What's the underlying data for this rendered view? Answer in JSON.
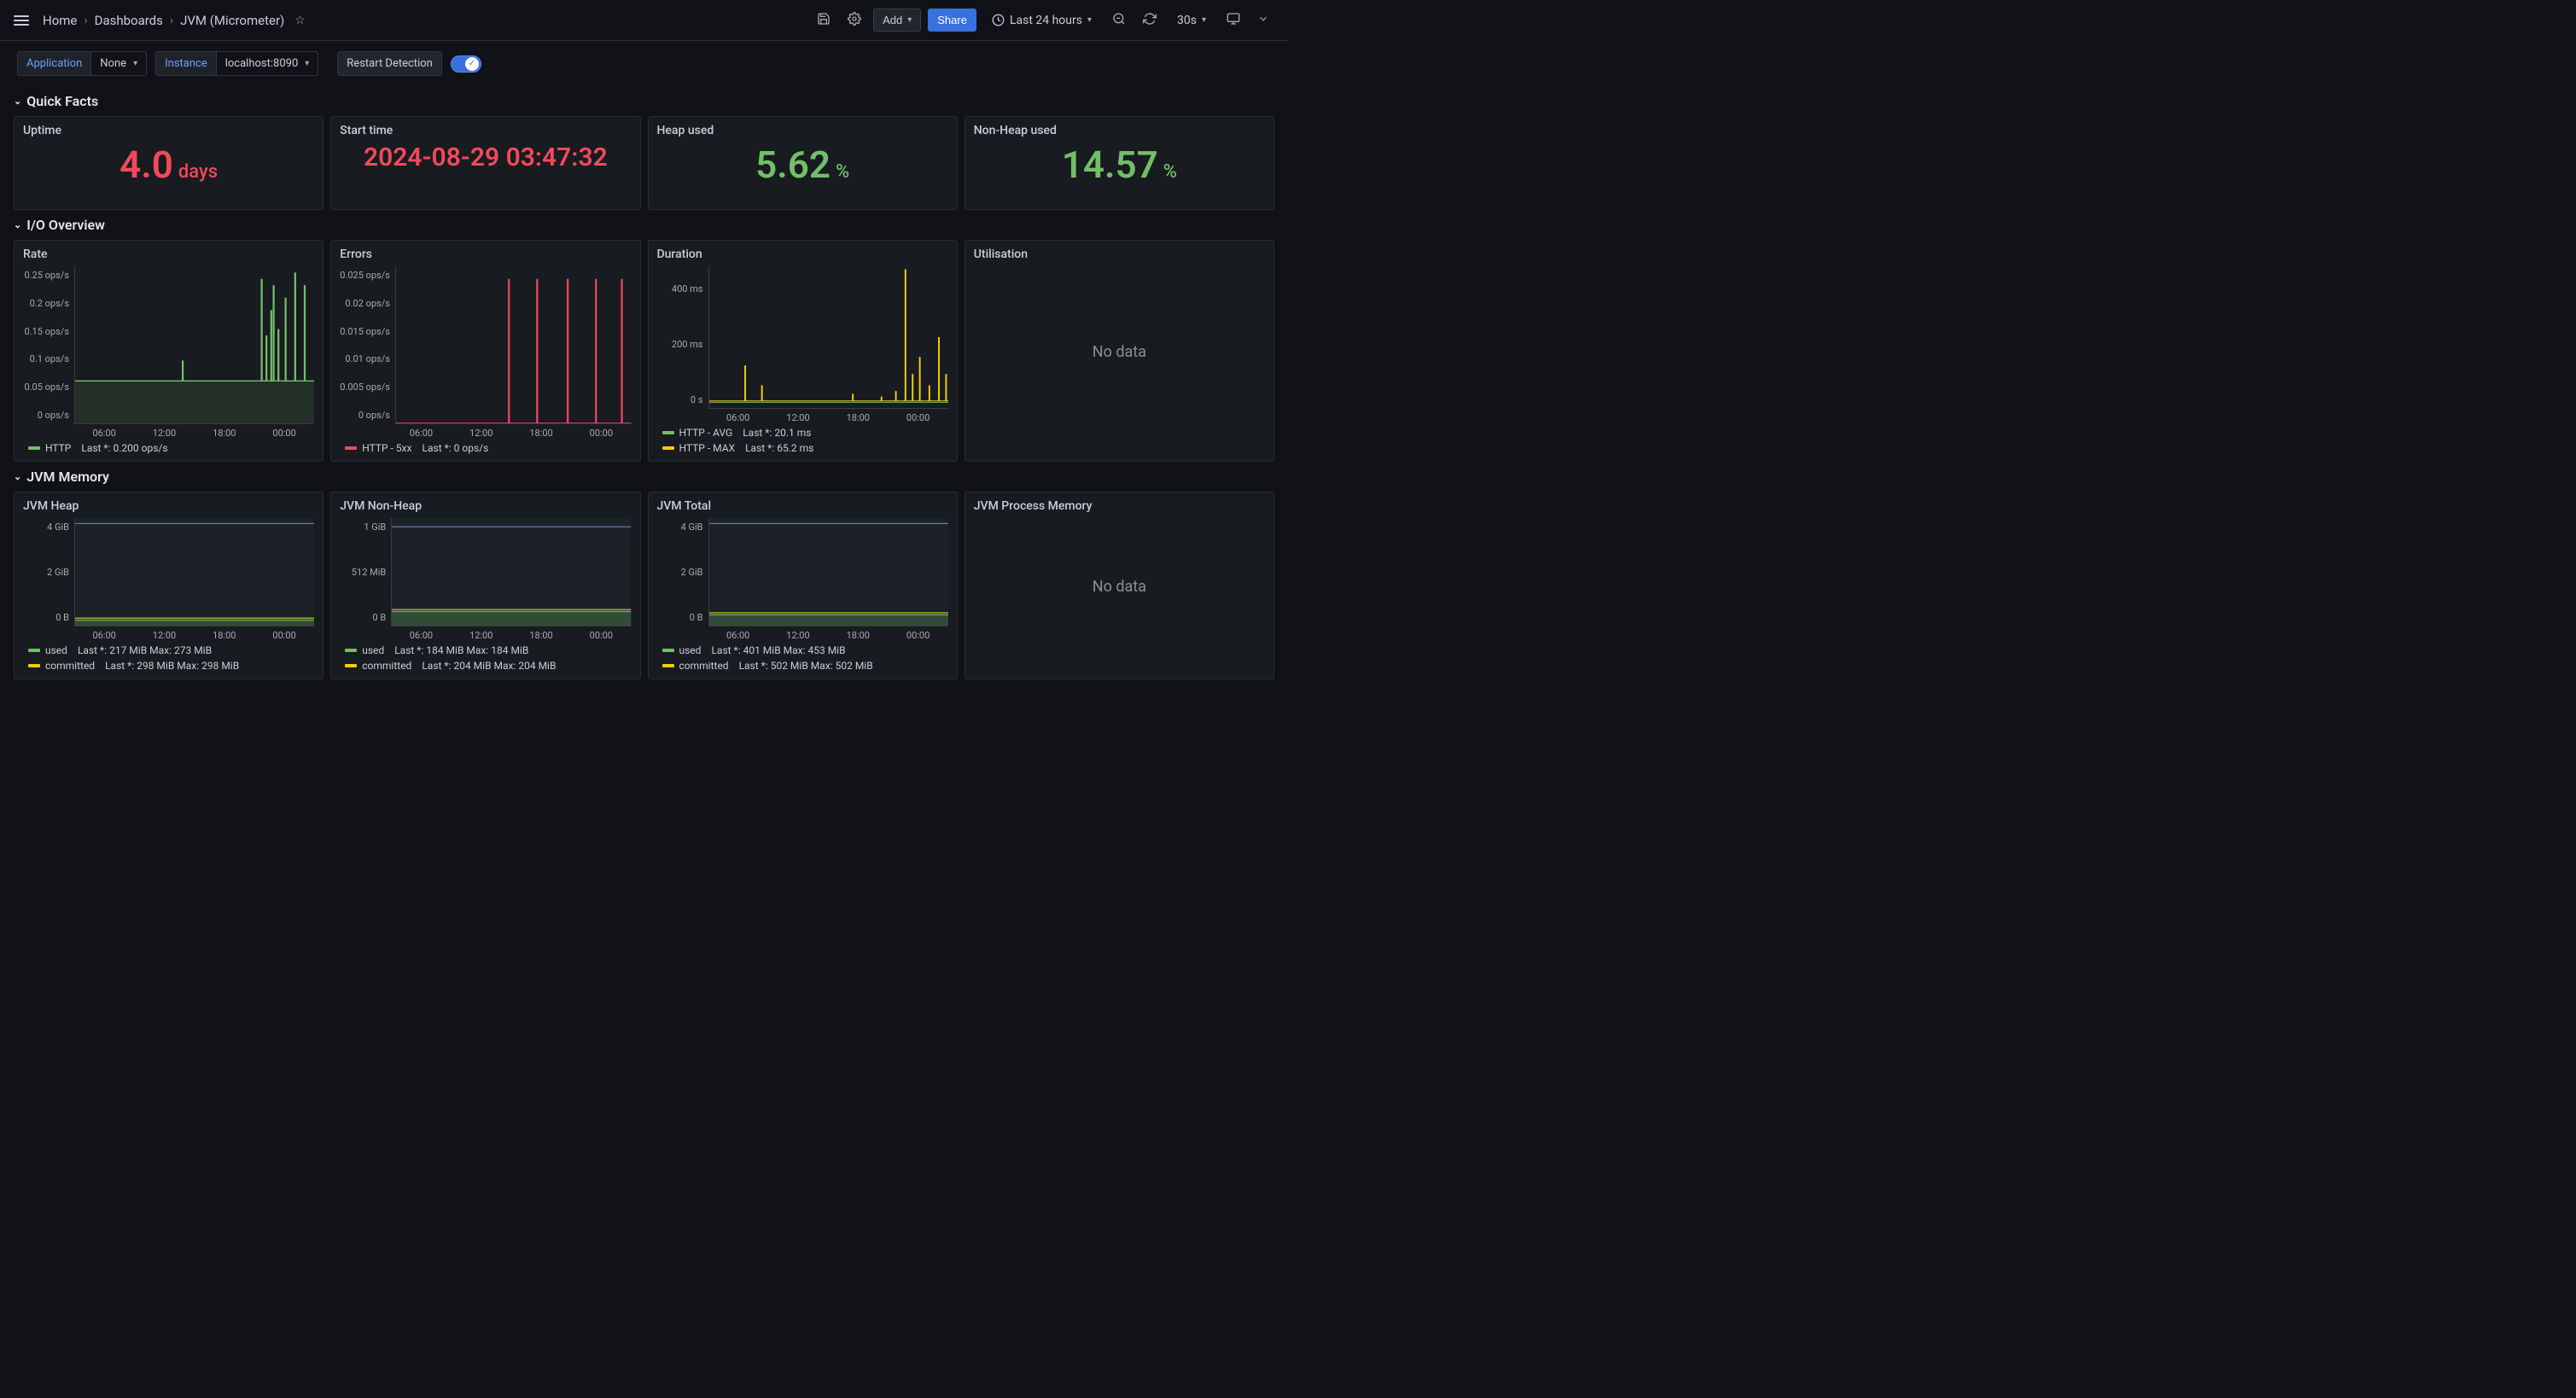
{
  "breadcrumbs": {
    "home": "Home",
    "dashboards": "Dashboards",
    "current": "JVM (Micrometer)"
  },
  "toolbar": {
    "add": "Add",
    "share": "Share",
    "timerange": "Last 24 hours",
    "refresh_interval": "30s"
  },
  "variables": {
    "application_label": "Application",
    "application_value": "None",
    "instance_label": "Instance",
    "instance_value": "localhost:8090",
    "restart_label": "Restart Detection"
  },
  "sections": {
    "quick_facts": "Quick Facts",
    "io_overview": "I/O Overview",
    "jvm_memory": "JVM Memory"
  },
  "quick_facts": {
    "uptime": {
      "title": "Uptime",
      "value": "4.0",
      "unit": "days"
    },
    "start_time": {
      "title": "Start time",
      "value": "2024-08-29 03:47:32"
    },
    "heap_used": {
      "title": "Heap used",
      "value": "5.62",
      "unit": "%"
    },
    "nonheap_used": {
      "title": "Non-Heap used",
      "value": "14.57",
      "unit": "%"
    }
  },
  "io": {
    "rate": {
      "title": "Rate",
      "yticks": [
        "0.25 ops/s",
        "0.2 ops/s",
        "0.15 ops/s",
        "0.1 ops/s",
        "0.05 ops/s",
        "0 ops/s"
      ],
      "xticks": [
        "06:00",
        "12:00",
        "18:00",
        "00:00"
      ],
      "legend": [
        {
          "name": "HTTP",
          "color": "#73bf69",
          "stat": "Last *: 0.200 ops/s"
        }
      ]
    },
    "errors": {
      "title": "Errors",
      "yticks": [
        "0.025 ops/s",
        "0.02 ops/s",
        "0.015 ops/s",
        "0.01 ops/s",
        "0.005 ops/s",
        "0 ops/s"
      ],
      "xticks": [
        "06:00",
        "12:00",
        "18:00",
        "00:00"
      ],
      "legend": [
        {
          "name": "HTTP - 5xx",
          "color": "#f2495c",
          "stat": "Last *: 0 ops/s"
        }
      ]
    },
    "duration": {
      "title": "Duration",
      "yticks": [
        "400 ms",
        "200 ms",
        "0 s"
      ],
      "xticks": [
        "06:00",
        "12:00",
        "18:00",
        "00:00"
      ],
      "legend": [
        {
          "name": "HTTP - AVG",
          "color": "#73bf69",
          "stat": "Last *: 20.1 ms"
        },
        {
          "name": "HTTP - MAX",
          "color": "#f2cc0c",
          "stat": "Last *: 65.2 ms"
        }
      ]
    },
    "utilisation": {
      "title": "Utilisation",
      "nodata": "No data"
    }
  },
  "memory": {
    "heap": {
      "title": "JVM Heap",
      "yticks": [
        "4 GiB",
        "2 GiB",
        "0 B"
      ],
      "xticks": [
        "06:00",
        "12:00",
        "18:00",
        "00:00"
      ],
      "legend": [
        {
          "name": "used",
          "color": "#73bf69",
          "stat": "Last *: 217 MiB   Max: 273 MiB"
        },
        {
          "name": "committed",
          "color": "#f2cc0c",
          "stat": "Last *: 298 MiB   Max: 298 MiB"
        }
      ]
    },
    "nonheap": {
      "title": "JVM Non-Heap",
      "yticks": [
        "1 GiB",
        "512 MiB",
        "0 B"
      ],
      "xticks": [
        "06:00",
        "12:00",
        "18:00",
        "00:00"
      ],
      "legend": [
        {
          "name": "used",
          "color": "#73bf69",
          "stat": "Last *: 184 MiB   Max: 184 MiB"
        },
        {
          "name": "committed",
          "color": "#f2cc0c",
          "stat": "Last *: 204 MiB   Max: 204 MiB"
        }
      ]
    },
    "total": {
      "title": "JVM Total",
      "yticks": [
        "4 GiB",
        "2 GiB",
        "0 B"
      ],
      "xticks": [
        "06:00",
        "12:00",
        "18:00",
        "00:00"
      ],
      "legend": [
        {
          "name": "used",
          "color": "#73bf69",
          "stat": "Last *: 401 MiB   Max: 453 MiB"
        },
        {
          "name": "committed",
          "color": "#f2cc0c",
          "stat": "Last *: 502 MiB   Max: 502 MiB"
        }
      ]
    },
    "process": {
      "title": "JVM Process Memory",
      "nodata": "No data"
    }
  },
  "chart_data": [
    {
      "panel": "Rate",
      "type": "line",
      "ylabel": "ops/s",
      "ylim": [
        0,
        0.25
      ],
      "xticks": [
        "06:00",
        "12:00",
        "18:00",
        "00:00"
      ],
      "series": [
        {
          "name": "HTTP",
          "baseline": 0.067,
          "spikes_x_pct": [
            45,
            78,
            80,
            82,
            83,
            85,
            88,
            92,
            96
          ],
          "spikes_val": [
            0.1,
            0.23,
            0.14,
            0.18,
            0.22,
            0.15,
            0.2,
            0.24,
            0.22
          ]
        }
      ]
    },
    {
      "panel": "Errors",
      "type": "line",
      "ylabel": "ops/s",
      "ylim": [
        0,
        0.025
      ],
      "xticks": [
        "06:00",
        "12:00",
        "18:00",
        "00:00"
      ],
      "series": [
        {
          "name": "HTTP - 5xx",
          "baseline": 0,
          "spikes_x_pct": [
            48,
            60,
            73,
            85,
            96
          ],
          "spikes_val": [
            0.023,
            0.023,
            0.023,
            0.023,
            0.023
          ]
        }
      ]
    },
    {
      "panel": "Duration",
      "type": "line",
      "ylabel": "ms",
      "ylim": [
        0,
        500
      ],
      "xticks": [
        "06:00",
        "12:00",
        "18:00",
        "00:00"
      ],
      "series": [
        {
          "name": "HTTP - AVG",
          "baseline": 20
        },
        {
          "name": "HTTP - MAX",
          "baseline": 25,
          "spikes_x_pct": [
            15,
            22,
            60,
            72,
            78,
            82,
            85,
            88,
            92,
            96,
            99
          ],
          "spikes_val": [
            150,
            80,
            50,
            40,
            60,
            490,
            120,
            180,
            80,
            250,
            120
          ]
        }
      ]
    },
    {
      "panel": "JVM Heap",
      "type": "area",
      "ylabel": "bytes",
      "ylim": [
        0,
        4294967296
      ],
      "series": [
        {
          "name": "used",
          "last": 227540992,
          "max": 286261248
        },
        {
          "name": "committed",
          "last": 312475648,
          "max": 312475648
        },
        {
          "name": "max_line",
          "value": 4080218931
        }
      ]
    },
    {
      "panel": "JVM Non-Heap",
      "type": "area",
      "ylabel": "bytes",
      "ylim": [
        0,
        1395864371
      ],
      "series": [
        {
          "name": "used",
          "last": 192937984,
          "max": 192937984
        },
        {
          "name": "committed",
          "last": 213909504,
          "max": 213909504
        },
        {
          "name": "max_line",
          "value": 1288490189
        }
      ]
    },
    {
      "panel": "JVM Total",
      "type": "area",
      "ylabel": "bytes",
      "ylim": [
        0,
        4294967296
      ],
      "series": [
        {
          "name": "used",
          "last": 420478976,
          "max": 475004928
        },
        {
          "name": "committed",
          "last": 526385152,
          "max": 526385152
        },
        {
          "name": "max_line",
          "value": 4080218931
        }
      ]
    }
  ]
}
